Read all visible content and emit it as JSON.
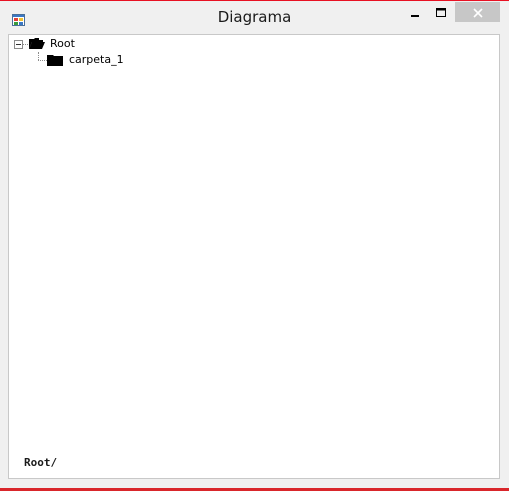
{
  "window": {
    "title": "Diagrama",
    "app_icon": "winforms-app-icon",
    "controls": {
      "minimize_icon": "minimize-icon",
      "maximize_icon": "maximize-icon",
      "close_icon": "close-icon"
    }
  },
  "tree": {
    "root": {
      "label": "Root",
      "icon": "folder-open-icon",
      "expanded": true,
      "children": [
        {
          "label": "carpeta_1",
          "icon": "folder-closed-icon"
        }
      ]
    }
  },
  "status": {
    "path": "Root/"
  },
  "colors": {
    "accent_red": "#e81123",
    "close_button_bg": "#c7c7c7",
    "titlebar_bg": "#f0f0f0"
  }
}
